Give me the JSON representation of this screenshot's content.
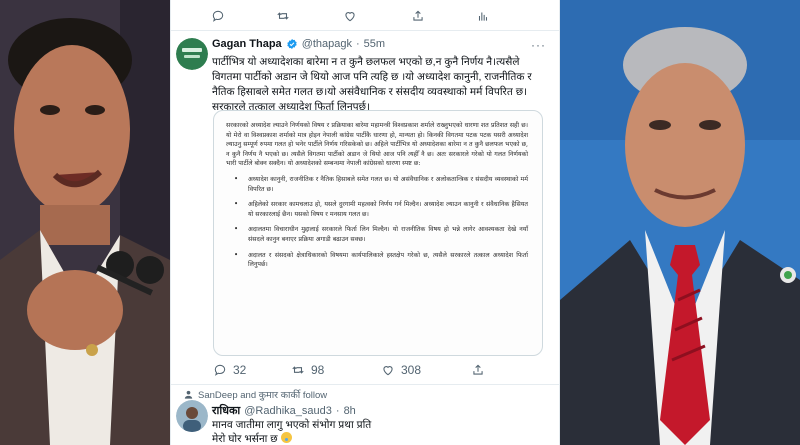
{
  "top_actions": {
    "reply_icon": "reply-icon",
    "retweet_icon": "retweet-icon",
    "like_icon": "heart-icon",
    "share_icon": "share-icon",
    "analytics_icon": "analytics-icon"
  },
  "tweet": {
    "name": "Gagan Thapa",
    "handle": "@thapagk",
    "dot": "·",
    "time": "55m",
    "more": "···",
    "avatar_text": "",
    "text_lines": [
      "पार्टीभित्र यो अध्यादेशका बारेमा न त कुनै छलफल भएको छ,न कुनै निर्णय नै।त्यसैले",
      "विगतमा पार्टीको अडान जे थियो आज पनि त्यहि छ ।यो अध्यादेश कानुनी, राजनीतिक र",
      "नैतिक हिसाबले समेत गलत छ।यो असंवैधानिक र संसदीय व्यवस्थाको मर्म विपरित छ।",
      "सरकारले तत्काल अध्यादेश फिर्ता लिनुपर्छ।"
    ],
    "document": {
      "intro": "सरकारको अध्यादेश ल्याउने निर्णयको विषय र प्रक्रियाका बारेमा महामन्त्री विश्वप्रकाश शर्माले राख्नुभएको धारणा शत प्रतिशत सही छ। यो मेरो वा विश्वप्रकाश शर्माको मात्र होइन नेपाली कांग्रेस पार्टीकै धारणा हो, मान्यता हो। किनकी विगतमा पटक पटक यसरी अध्यादेश ल्याउनु सम्पूर्ण रुपमा गलत हो भनेर पार्टीले निर्णय गरिसकेको छ। अहिले पार्टीभित्र यो अध्यादेशका बारेमा न त कुनै छलफल भएको छ, न कुनै निर्णय नै भएको छ। त्यसैले विगतमा पार्टीको अडान जे थियो आज पनि त्यहीँ नै छ। अतः सरकारले गरेको यो गलत निर्णयको भारी पार्टीले बोक्न सक्दैन। यो अध्यादेशको सम्बन्धमा नेपाली कांग्रेसको धारणा स्पष्ट छ:",
      "bullets": [
        "अध्यादेश कानुनी, राजनीतिक र नैतिक हिसाबले समेत गलत छ। यो असंवैधानिक र अलोकतान्त्रिक र संसदीय व्यवस्थाको मर्म विपरित छ।",
        "अहिलेको सरकार कामचलाउ हो, यसले दुरगामी महत्वको निर्णय गर्न मिल्दैन। अध्यादेश ल्याउन कानुनी र संवैधानिक हैसियत यो सरकारलाई छैन। यसको विषय र मनसाय गलत छ।",
        "अदालतमा विचाराधीन मुद्दालाई सरकारले फिर्ता लिन मिल्दैन। यो राजनीतिक विषय हो भन्ने लागेर आवश्यकता देखे नयाँ संसदले कानुन बनाएर प्रक्रिया अगाडी बढाउन सक्छ।",
        "अदालत र संसदको क्षेत्राधिकारको विषयमा कार्यपालिकाले हस्तक्षेप गरेको छ, त्यसैले सरकारले तत्काल अध्यादेश फिर्ता लिनुपर्छ।"
      ]
    },
    "counts": {
      "replies": "32",
      "retweets": "98",
      "likes": "308"
    }
  },
  "reply": {
    "follow_line": "SanDeep and कुमार कार्की follow",
    "name": "राधिका",
    "handle": "@Radhika_saud3",
    "dot": "·",
    "time": "8h",
    "line1": "मानव जातीमा लागु भएको संभोग प्रथा प्रति",
    "line2": "मेरो घोर भर्सना छ",
    "emoji_icon": "sad-face-emoji-icon"
  },
  "colors": {
    "text_primary": "#0f1419",
    "text_secondary": "#536471",
    "border": "#e6ecf0",
    "verified_blue": "#1d9bf0"
  }
}
